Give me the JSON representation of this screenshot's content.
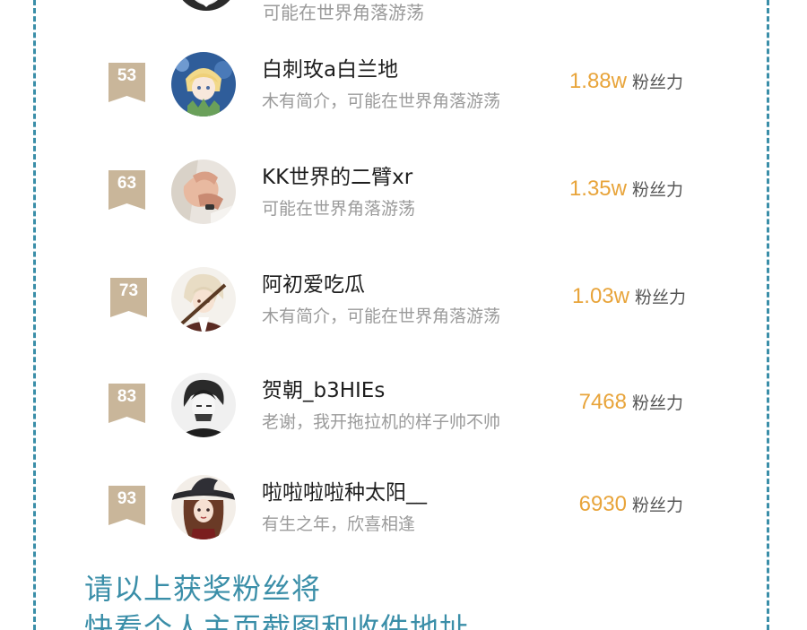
{
  "partial_row": {
    "desc": "可能在世界角落游荡"
  },
  "ranking": [
    {
      "rank": "53",
      "name": "白刺玫a白兰地",
      "desc": "木有简介，可能在世界角落游荡",
      "fans": "1.88w",
      "fans_label": "粉丝力",
      "avatar": "avatar-blonde-boy-anime"
    },
    {
      "rank": "63",
      "name": "KK世界的二臂xr",
      "desc": "可能在世界角落游荡",
      "fans": "1.35w",
      "fans_label": "粉丝力",
      "avatar": "avatar-holding-hands"
    },
    {
      "rank": "73",
      "name": "阿初爱吃瓜",
      "desc": "木有简介，可能在世界角落游荡",
      "fans": "1.03w",
      "fans_label": "粉丝力",
      "avatar": "avatar-white-hair-anime"
    },
    {
      "rank": "83",
      "name": "贺朝_b3HIEs",
      "desc": "老谢，我开拖拉机的样子帅不帅",
      "fans": "7468",
      "fans_label": "粉丝力",
      "avatar": "avatar-dark-hair-sketch"
    },
    {
      "rank": "93",
      "name": "啦啦啦啦种太阳__",
      "desc": "有生之年，欣喜相逢",
      "fans": "6930",
      "fans_label": "粉丝力",
      "avatar": "avatar-witch-hat-girl"
    }
  ],
  "footer": {
    "line1": "请以上获奖粉丝将",
    "line2": "快看个人主页截图和收件地址"
  },
  "colors": {
    "accent": "#3a8ea8",
    "fans_number": "#e8a43a",
    "rank_badge": "#c9b69a"
  }
}
